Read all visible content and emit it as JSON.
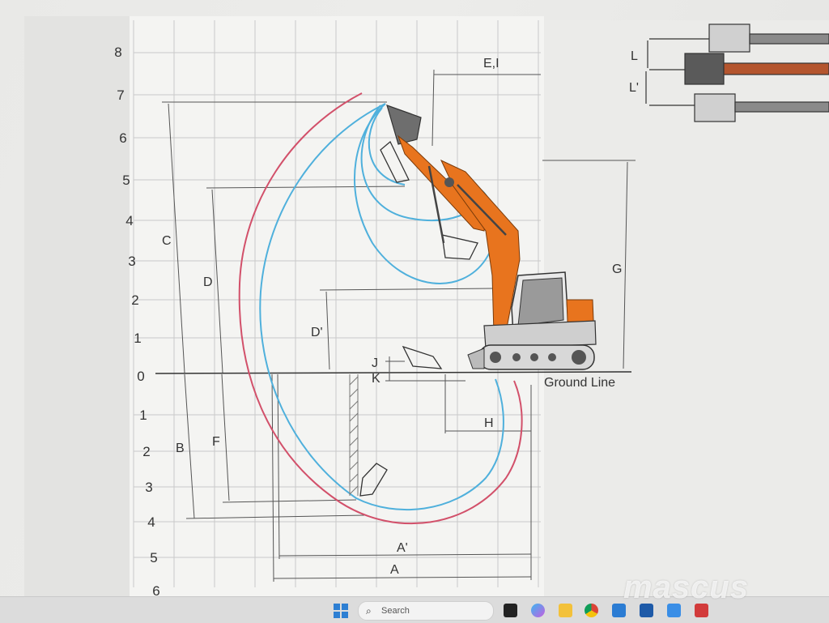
{
  "diagram": {
    "y_axis_labels": [
      "8",
      "7",
      "6",
      "5",
      "4",
      "3",
      "2",
      "1",
      "0",
      "1",
      "2",
      "3",
      "4",
      "5",
      "6"
    ],
    "dimension_labels": {
      "A": "A",
      "A_prime": "A'",
      "B": "B",
      "C": "C",
      "D": "D",
      "D_prime": "D'",
      "EI": "E,I",
      "F": "F",
      "G": "G",
      "H": "H",
      "J": "J",
      "K": "K",
      "L": "L",
      "L_prime": "L'"
    },
    "ground_line_label": "Ground Line",
    "colors": {
      "max_reach_curve": "#d2506a",
      "work_range_curve": "#4fb0dc",
      "machine_orange": "#e8741e",
      "dimension_lines": "#555555"
    }
  },
  "taskbar": {
    "search_placeholder": "Search",
    "apps": [
      "windows-start-icon",
      "search-icon",
      "task-view-icon",
      "copilot-icon",
      "file-explorer-icon",
      "chrome-icon",
      "store-icon",
      "app-icon",
      "app-icon",
      "app-icon"
    ]
  },
  "watermark": {
    "text": "mascus"
  }
}
